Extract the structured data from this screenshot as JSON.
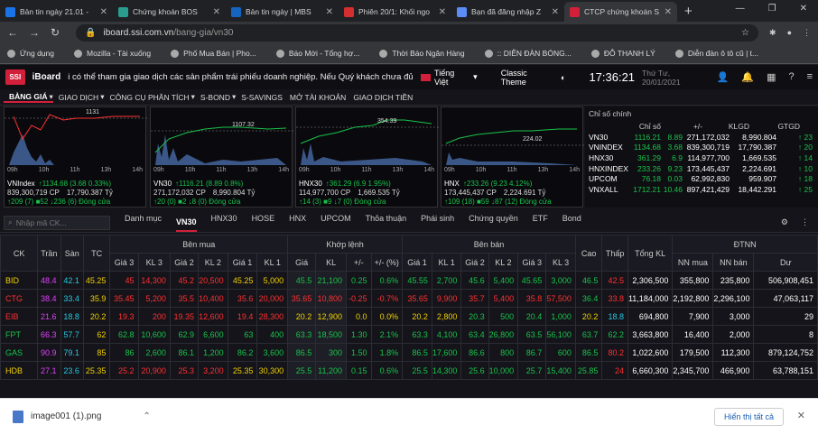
{
  "browser": {
    "tabs": [
      {
        "title": "Bản tin ngày 21.01 -",
        "color": "#1a73e8"
      },
      {
        "title": "Chứng khoán BOS",
        "color": "#2a9d8f"
      },
      {
        "title": "Bản tin ngày | MBS",
        "color": "#1565c0"
      },
      {
        "title": "Phiên 20/1: Khối ngo",
        "color": "#d32f2f"
      },
      {
        "title": "Bạn đã đăng nhập Z",
        "color": "#5b8df5"
      },
      {
        "title": "CTCP chứng khoán S",
        "color": "#d3203a"
      }
    ],
    "url_host": "iboard.ssi.com.vn",
    "url_path": "/bang-gia/vn30",
    "bookmarks": [
      "Ứng dụng",
      "Mozilla - Tài xuống",
      "Phố Mua Bán | Pho...",
      "Báo Mới - Tổng hợ...",
      "Thời Báo Ngân Hàng",
      ":: DIỄN ĐÀN BÓNG...",
      "ĐỖ THANH LÝ",
      "Diễn đàn ô tô cũ | t..."
    ]
  },
  "header": {
    "logo": "SSI",
    "brand": "iBoard",
    "marquee": "i có thể tham gia giao dịch các sản phẩm trái phiếu doanh nghiệp. Nếu Quý khách chưa đủ điều",
    "language": "Tiếng Việt",
    "theme": "Classic Theme",
    "clock": "17:36:21",
    "date": "Thứ Tư, 20/01/2021"
  },
  "menu": [
    "BẢNG GIÁ",
    "GIAO DỊCH",
    "CÔNG CỤ PHÂN TÍCH",
    "S-BOND",
    "S-SAVINGS",
    "MỞ TÀI KHOẢN",
    "GIAO DỊCH TIỀN"
  ],
  "charts": [
    {
      "ref": "1131",
      "ticks": [
        "09h",
        "10h",
        "11h",
        "13h",
        "14h"
      ],
      "l1a": "VNIndex",
      "l1b": "↑1134.68 (3.68 0.33%)",
      "l2a": "839,300,719 CP",
      "l2b": "17,790.387 Tỷ",
      "l3": "↑209 (7)  ■52  ↓236 (6)  Đóng cửa"
    },
    {
      "ref": "1107.32",
      "ticks": [
        "09h",
        "10h",
        "11h",
        "13h",
        "14h"
      ],
      "l1a": "VN30",
      "l1b": "↑1116.21 (8.89 0.8%)",
      "l2a": "271,172,032 CP",
      "l2b": "8,990.804 Tỷ",
      "l3": "↑20 (0)  ■2  ↓8 (0)  Đóng cửa"
    },
    {
      "ref": "354.39",
      "ticks": [
        "09h",
        "10h",
        "11h",
        "13h",
        "14h"
      ],
      "l1a": "HNX30",
      "l1b": "↑361.29 (6.9 1.95%)",
      "l2a": "114,977,700 CP",
      "l2b": "1,669.535 Tỷ",
      "l3": "↑14 (3)  ■9  ↓7 (0)  Đóng cửa"
    },
    {
      "ref": "224.02",
      "ticks": [
        "09h",
        "10h",
        "11h",
        "13h",
        "14h"
      ],
      "l1a": "HNX",
      "l1b": "↑233.26 (9.23 4.12%)",
      "l2a": "173,445,437 CP",
      "l2b": "2,224.691 Tỷ",
      "l3": "↑109 (18)  ■59  ↓87 (12)  Đóng cửa"
    }
  ],
  "indices": {
    "title": "Chỉ số chính",
    "headers": [
      "Chỉ số",
      "+/-",
      "KLGD",
      "GTGD"
    ],
    "rows": [
      [
        "VN30",
        "1116.21",
        "8.89",
        "271,172,032",
        "8,990.804",
        "↑ 23"
      ],
      [
        "VNINDEX",
        "1134.68",
        "3.68",
        "839,300,719",
        "17,790.387",
        "↑ 20"
      ],
      [
        "HNX30",
        "361.29",
        "6.9",
        "114,977,700",
        "1,669.535",
        "↑ 14"
      ],
      [
        "HNXINDEX",
        "233.26",
        "9.23",
        "173,445,437",
        "2,224.691",
        "↑ 10"
      ],
      [
        "UPCOM",
        "76.18",
        "0.03",
        "62,992,830",
        "959.907",
        "↑ 18"
      ],
      [
        "VNXALL",
        "1712.21",
        "10.46",
        "897,421,429",
        "18,442.291",
        "↑ 25"
      ]
    ]
  },
  "subtabs": {
    "search_placeholder": "Nhập mã CK...",
    "items": [
      "Danh mục",
      "VN30",
      "HNX30",
      "HOSE",
      "HNX",
      "UPCOM",
      "Thỏa thuận",
      "Phái sinh",
      "Chứng quyền",
      "ETF",
      "Bond"
    ]
  },
  "table": {
    "groups": [
      "CK",
      "Trần",
      "Sàn",
      "TC",
      "Bên mua",
      "Khớp lệnh",
      "Bên bán",
      "Cao",
      "Thấp",
      "Tổng KL",
      "ĐTNN"
    ],
    "cols": [
      "Giá 3",
      "KL 3",
      "Giá 2",
      "KL 2",
      "Giá 1",
      "KL 1",
      "Giá",
      "KL",
      "+/-",
      "+/- (%)",
      "Giá 1",
      "KL 1",
      "Giá 2",
      "KL 2",
      "Giá 3",
      "KL 3",
      "NN mua",
      "NN bán",
      "Dư"
    ],
    "rows": [
      [
        "BID",
        "48.4",
        "42.1",
        "45.25",
        "45",
        "14,300",
        "45.2",
        "20,500",
        "45.25",
        "5,000",
        "45.5",
        "21,100",
        "0.25",
        "0.6%",
        "45.55",
        "2,700",
        "45.6",
        "5,400",
        "45.65",
        "3,000",
        "46.5",
        "42.5",
        "2,306,500",
        "355,800",
        "235,800",
        "506,908,451"
      ],
      [
        "CTG",
        "38.4",
        "33.4",
        "35.9",
        "35.45",
        "5,200",
        "35.5",
        "10,400",
        "35.6",
        "20,000",
        "35.65",
        "10,800",
        "-0.25",
        "-0.7%",
        "35.65",
        "9,900",
        "35.7",
        "5,400",
        "35.8",
        "57,500",
        "36.4",
        "33.8",
        "11,184,000",
        "2,192,800",
        "2,296,100",
        "47,063,117"
      ],
      [
        "EIB",
        "21.6",
        "18.8",
        "20.2",
        "19.3",
        "200",
        "19.35",
        "12,600",
        "19.4",
        "28,300",
        "20.2",
        "12,900",
        "0.0",
        "0.0%",
        "20.2",
        "2,800",
        "20.3",
        "500",
        "20.4",
        "1,000",
        "20.2",
        "18.8",
        "694,800",
        "7,900",
        "3,000",
        "29"
      ],
      [
        "FPT",
        "66.3",
        "57.7",
        "62",
        "62.8",
        "10,600",
        "62.9",
        "6,600",
        "63",
        "400",
        "63.3",
        "18,500",
        "1.30",
        "2.1%",
        "63.3",
        "4,100",
        "63.4",
        "26,800",
        "63.5",
        "56,100",
        "63.7",
        "62.2",
        "3,663,800",
        "16,400",
        "2,000",
        "8"
      ],
      [
        "GAS",
        "90.9",
        "79.1",
        "85",
        "86",
        "2,600",
        "86.1",
        "1,200",
        "86.2",
        "3,600",
        "86.5",
        "300",
        "1.50",
        "1.8%",
        "86.5",
        "17,600",
        "86.6",
        "800",
        "86.7",
        "600",
        "86.5",
        "80.2",
        "1,022,600",
        "179,500",
        "112,300",
        "879,124,752"
      ],
      [
        "HDB",
        "27.1",
        "23.6",
        "25.35",
        "25.2",
        "20,900",
        "25.3",
        "3,200",
        "25.35",
        "30,300",
        "25.5",
        "11,200",
        "0.15",
        "0.6%",
        "25.5",
        "14,300",
        "25.6",
        "10,000",
        "25.7",
        "15,400",
        "25.85",
        "24",
        "6,660,300",
        "2,345,700",
        "466,900",
        "63,788,151"
      ]
    ]
  },
  "download": {
    "file": "image001 (1).png",
    "show_all": "Hiển thị tất cả"
  }
}
